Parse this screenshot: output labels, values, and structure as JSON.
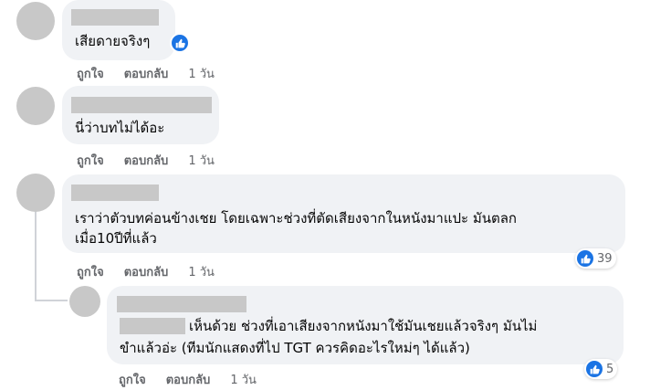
{
  "comments": [
    {
      "text_lines": [
        "เสียดายจริงๆ"
      ],
      "actions": {
        "like": "ถูกใจ",
        "reply": "ตอบกลับ",
        "time": "1 วัน"
      }
    },
    {
      "text_lines": [
        "นี่ว่าบทไม่ได้อะ"
      ],
      "actions": {
        "like": "ถูกใจ",
        "reply": "ตอบกลับ",
        "time": "1 วัน"
      }
    },
    {
      "text_lines": [
        "เราว่าตัวบทค่อนข้างเชย โดยเฉพาะช่วงที่ตัดเสียงจากในหนังมาแปะ มันตลก",
        "เมื่อ10ปีที่แล้ว"
      ],
      "reaction_count": "39",
      "actions": {
        "like": "ถูกใจ",
        "reply": "ตอบกลับ",
        "time": "1 วัน"
      }
    }
  ],
  "reply": {
    "text_lines": [
      "เห็นด้วย ช่วงที่เอาเสียงจากหนังมาใช้มันเชยแล้วจริงๆ มันไม่",
      "ขำแล้วอ่ะ (ทีมนักแสดงที่ไป TGT ควรคิดอะไรใหม่ๆ ได้แล้ว)"
    ],
    "reaction_count": "5",
    "actions": {
      "like": "ถูกใจ",
      "reply": "ตอบกลับ",
      "time": "1 วัน"
    }
  },
  "icons": {
    "reaction": "like-thumb-icon",
    "accent": "#1b74e4"
  }
}
